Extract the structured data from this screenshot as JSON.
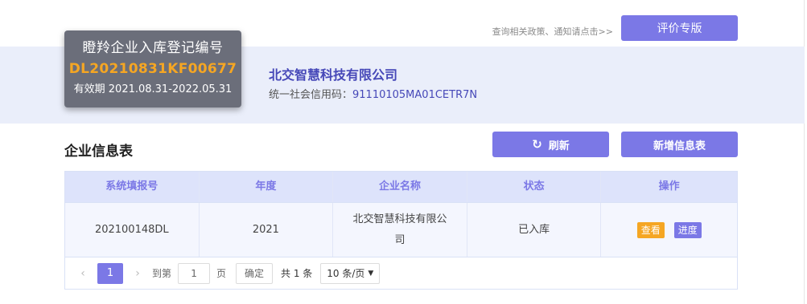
{
  "top": {
    "notice_link": "查询相关政策、通知请点击>>",
    "eval_button": "评价专版"
  },
  "badge": {
    "title": "瞪羚企业入库登记编号",
    "number": "DL20210831KF00677",
    "validity": "有效期 2021.08.31-2022.05.31"
  },
  "company": {
    "name": "北交智慧科技有限公司",
    "credit_label": "统一社会信用码：",
    "credit_code": "91110105MA01CETR7N"
  },
  "section": {
    "title": "企业信息表",
    "refresh_button": "刷新",
    "add_button": "新增信息表"
  },
  "icons": {
    "refresh": "refresh-icon",
    "prev": "chevron-left-icon",
    "next": "chevron-right-icon",
    "dropdown": "caret-down-icon"
  },
  "table": {
    "headers": [
      "系统填报号",
      "年度",
      "企业名称",
      "状态",
      "操作"
    ],
    "rows": [
      {
        "id": "202100148DL",
        "year": "2021",
        "company": "北交智慧科技有限公司",
        "status": "已入库",
        "actions": [
          "查看",
          "进度"
        ]
      }
    ]
  },
  "pager": {
    "current_page": "1",
    "goto_label": "到第",
    "goto_value": "1",
    "page_unit": "页",
    "confirm": "确定",
    "total": "共 1 条",
    "page_size": "10 条/页"
  },
  "colors": {
    "accent": "#7b78e6",
    "warning": "#f5a623",
    "banner_bg": "#eaeefa",
    "badge_bg": "#6b6e7a"
  }
}
